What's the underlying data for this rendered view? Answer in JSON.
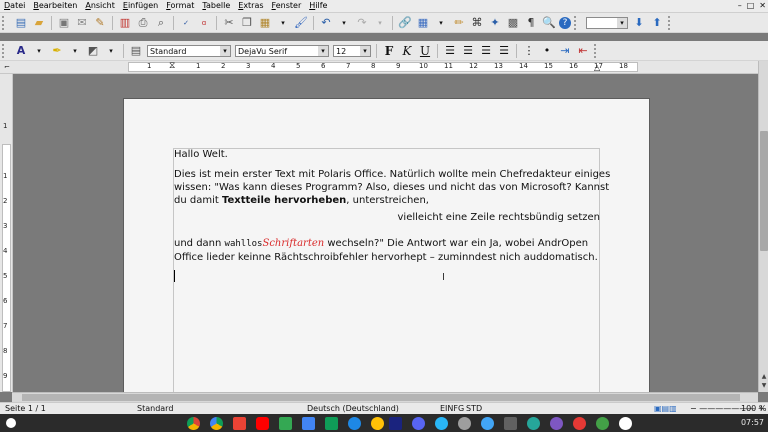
{
  "menu": [
    "Datei",
    "Bearbeiten",
    "Ansicht",
    "Einfügen",
    "Format",
    "Tabelle",
    "Extras",
    "Fenster",
    "Hilfe"
  ],
  "window_controls": [
    "–",
    "□",
    "✕"
  ],
  "format_bar": {
    "style": "Standard",
    "font": "DejaVu Serif",
    "size": "12",
    "bold": "F",
    "italic": "K",
    "underline": "U"
  },
  "ruler": [
    "1",
    "1",
    "2",
    "3",
    "4",
    "5",
    "6",
    "7",
    "8",
    "9",
    "10",
    "11",
    "12",
    "13",
    "14",
    "15",
    "16",
    "17",
    "18"
  ],
  "vruler": [
    "1",
    "1",
    "2",
    "3",
    "4",
    "5",
    "6",
    "7",
    "8",
    "9"
  ],
  "document": {
    "line1": "Hallo Welt.",
    "p2_l1": "Dies ist mein erster Text mit Polaris Office. Natürlich wollte mein Chefredakteur einiges",
    "p2_l2": "wissen: \"Was kann dieses Programm? Also, dieses und nicht das von Microsoft? Kannst",
    "p2_l3a": "du damit ",
    "p2_l3b": "Textteile hervorheben",
    "p2_l3c": ", unterstreichen,",
    "p3": "vielleicht eine Zeile rechtsbündig setzen",
    "p4_a": "und dann ",
    "p4_b": "wahllos",
    "p4_c": "Schriftarten",
    "p4_d": " wechseln?\" Die Antwort war ein Ja, wobei AndrOpen",
    "p4_l2": "Office lieder keinne Rächtschroibfehler hervorhept – zuminndest nich auddomatisch."
  },
  "status": {
    "page": "Seite 1 / 1",
    "style": "Standard",
    "language": "Deutsch (Deutschland)",
    "mode": "EINFG",
    "sel": "STD",
    "zoom": "100 %"
  },
  "taskbar": {
    "time": "07:57"
  }
}
